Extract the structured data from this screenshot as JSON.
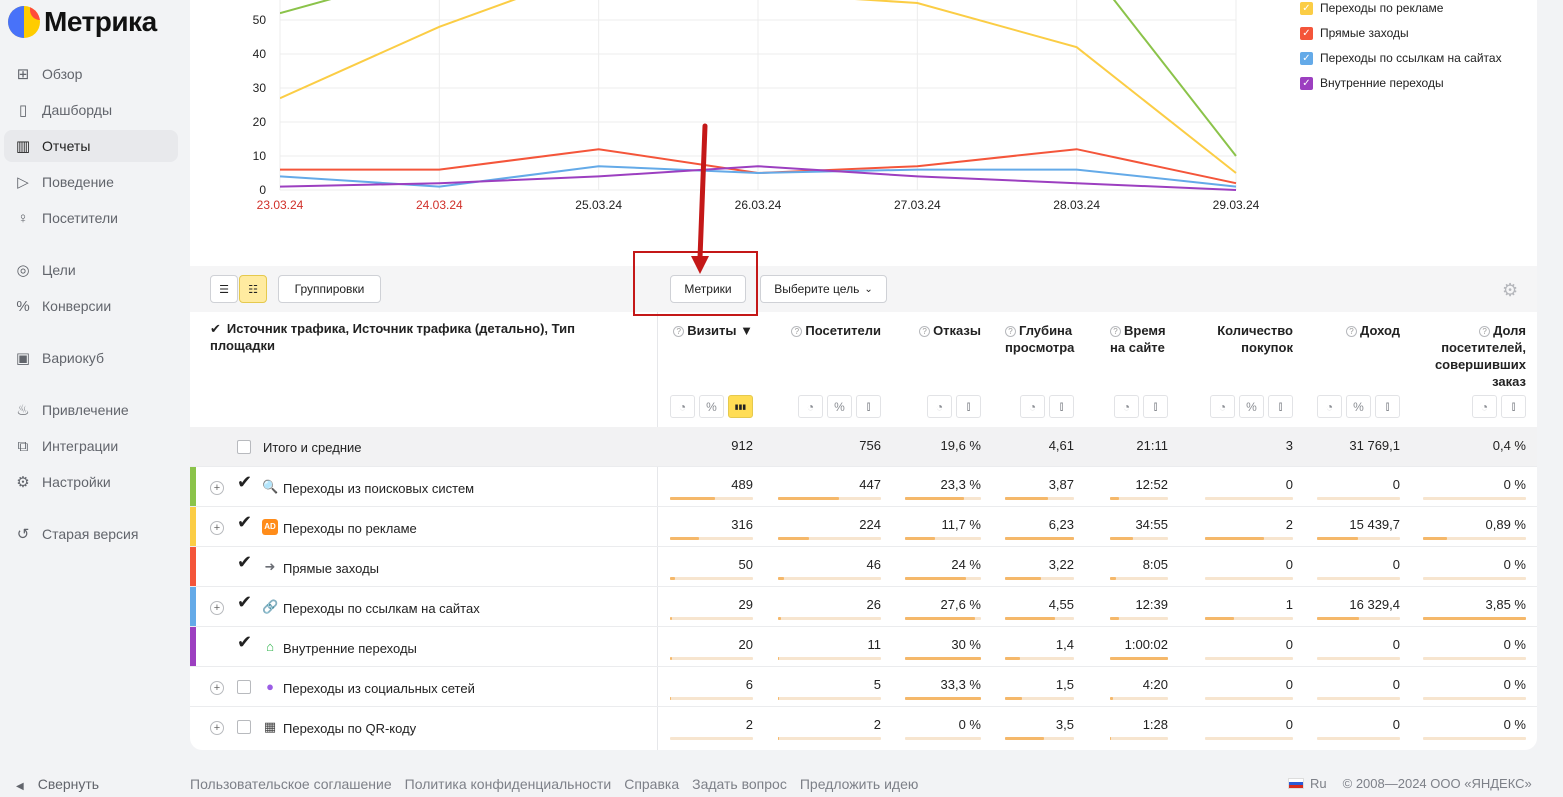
{
  "brand": {
    "name": "Метрика"
  },
  "nav": [
    {
      "label": "Обзор",
      "icon": "grid-icon"
    },
    {
      "label": "Дашборды",
      "icon": "dashboard-icon"
    },
    {
      "label": "Отчеты",
      "icon": "bar-chart-icon",
      "active": true
    },
    {
      "label": "Поведение",
      "icon": "play-icon"
    },
    {
      "label": "Посетители",
      "icon": "person-icon"
    },
    {
      "label": "Цели",
      "icon": "target-icon"
    },
    {
      "label": "Конверсии",
      "icon": "percent-icon"
    },
    {
      "label": "Вариокуб",
      "icon": "cube-icon"
    },
    {
      "label": "Привлечение",
      "icon": "fire-icon"
    },
    {
      "label": "Интеграции",
      "icon": "puzzle-icon"
    },
    {
      "label": "Настройки",
      "icon": "gear-icon"
    },
    {
      "label": "Старая версия",
      "icon": "undo-icon"
    }
  ],
  "collapse_label": "Свернуть",
  "chart_data": {
    "type": "line",
    "x": [
      "23.03.24",
      "24.03.24",
      "25.03.24",
      "26.03.24",
      "27.03.24",
      "28.03.24",
      "29.03.24"
    ],
    "weekend_x": [
      "23.03.24",
      "24.03.24"
    ],
    "yticks": [
      0,
      10,
      20,
      30,
      40,
      50
    ],
    "ylim": [
      0,
      56
    ],
    "series": [
      {
        "name": "",
        "color": "#8bc34a",
        "values": [
          52,
          65,
          75,
          78,
          80,
          70,
          10
        ]
      },
      {
        "name": "Переходы по рекламе",
        "color": "#fbcd45",
        "values": [
          27,
          48,
          65,
          58,
          55,
          42,
          5
        ]
      },
      {
        "name": "Прямые заходы",
        "color": "#f4553a",
        "values": [
          6,
          6,
          12,
          5,
          7,
          12,
          2
        ]
      },
      {
        "name": "Переходы по ссылкам на сайтах",
        "color": "#64aae8",
        "values": [
          4,
          1,
          7,
          5,
          6,
          6,
          1
        ]
      },
      {
        "name": "Внутренние переходы",
        "color": "#9c3fc0",
        "values": [
          1,
          2,
          4,
          7,
          4,
          2,
          0
        ]
      }
    ]
  },
  "toolbar": {
    "groupings_label": "Группировки",
    "metrics_label": "Метрики",
    "goal_label": "Выберите цель"
  },
  "table": {
    "dimension_header": "Источник трафика, Источник трафика (детально), Тип площадки",
    "columns": [
      {
        "title": "Визиты ▼",
        "help": true,
        "buttons": [
          "pie",
          "percent",
          "bars-on"
        ]
      },
      {
        "title": "Посетители",
        "help": true,
        "buttons": [
          "pie",
          "percent",
          "bars"
        ]
      },
      {
        "title": "Отказы",
        "help": true,
        "buttons": [
          "pie",
          "bars"
        ]
      },
      {
        "title": "Глубина просмотра",
        "help": true,
        "buttons": [
          "pie",
          "bars"
        ]
      },
      {
        "title": "Время на сайте",
        "help": true,
        "buttons": [
          "pie",
          "bars"
        ]
      },
      {
        "title": "Количество покупок",
        "help": false,
        "buttons": [
          "pie",
          "percent",
          "bars"
        ]
      },
      {
        "title": "Доход",
        "help": true,
        "buttons": [
          "pie",
          "percent",
          "bars"
        ]
      },
      {
        "title": "Доля посетителей, совершивших заказ",
        "help": true,
        "buttons": [
          "pie",
          "bars"
        ]
      }
    ],
    "total": {
      "label": "Итого и средние",
      "values": [
        "912",
        "756",
        "19,6 %",
        "4,61",
        "21:11",
        "3",
        "31 769,1",
        "0,4 %"
      ]
    },
    "rows": [
      {
        "label": "Переходы из поисковых систем",
        "stripe": "#8bc34a",
        "expand": true,
        "checked": true,
        "icon": "🔍",
        "icon_name": "search-icon",
        "icon_color": "#e84b3a",
        "values": [
          "489",
          "447",
          "23,3 %",
          "3,87",
          "12:52",
          "0",
          "0",
          "0 %"
        ],
        "bars": [
          0.54,
          0.59,
          0.78,
          0.62,
          0.15,
          0,
          0,
          0
        ]
      },
      {
        "label": "Переходы по рекламе",
        "stripe": "#fbcd45",
        "expand": true,
        "checked": true,
        "icon": "AD",
        "icon_name": "ad-icon",
        "icon_color": "#ff8c1a",
        "values": [
          "316",
          "224",
          "11,7 %",
          "6,23",
          "34:55",
          "2",
          "15 439,7",
          "0,89 %"
        ],
        "bars": [
          0.35,
          0.3,
          0.39,
          1.0,
          0.4,
          0.67,
          0.49,
          0.23
        ]
      },
      {
        "label": "Прямые заходы",
        "stripe": "#f4553a",
        "expand": false,
        "checked": true,
        "icon": "➜",
        "icon_name": "direct-icon",
        "icon_color": "#6b6e75",
        "values": [
          "50",
          "46",
          "24 %",
          "3,22",
          "8:05",
          "0",
          "0",
          "0 %"
        ],
        "bars": [
          0.06,
          0.06,
          0.8,
          0.52,
          0.1,
          0,
          0,
          0
        ]
      },
      {
        "label": "Переходы по ссылкам на сайтах",
        "stripe": "#64aae8",
        "expand": true,
        "checked": true,
        "icon": "🔗",
        "icon_name": "link-icon",
        "icon_color": "#3b82d8",
        "values": [
          "29",
          "26",
          "27,6 %",
          "4,55",
          "12:39",
          "1",
          "16 329,4",
          "3,85 %"
        ],
        "bars": [
          0.03,
          0.03,
          0.92,
          0.73,
          0.15,
          0.33,
          0.51,
          1.0
        ]
      },
      {
        "label": "Внутренние переходы",
        "stripe": "#9c3fc0",
        "expand": false,
        "checked": true,
        "icon": "⌂",
        "icon_name": "home-icon",
        "icon_color": "#2db34a",
        "values": [
          "20",
          "11",
          "30 %",
          "1,4",
          "1:00:02",
          "0",
          "0",
          "0 %"
        ],
        "bars": [
          0.02,
          0.01,
          1.0,
          0.22,
          1.0,
          0,
          0,
          0
        ]
      },
      {
        "label": "Переходы из социальных сетей",
        "stripe": "",
        "expand": true,
        "checked": false,
        "icon": "●",
        "icon_name": "social-icon",
        "icon_color": "#9b5de5",
        "values": [
          "6",
          "5",
          "33,3 %",
          "1,5",
          "4:20",
          "0",
          "0",
          "0 %"
        ],
        "bars": [
          0.01,
          0.01,
          1.0,
          0.24,
          0.05,
          0,
          0,
          0
        ]
      },
      {
        "label": "Переходы по QR-коду",
        "stripe": "",
        "expand": true,
        "checked": false,
        "icon": "▦",
        "icon_name": "qr-code-icon",
        "icon_color": "#444",
        "values": [
          "2",
          "2",
          "0 %",
          "3,5",
          "1:28",
          "0",
          "0",
          "0 %"
        ],
        "bars": [
          0.005,
          0.005,
          0,
          0.56,
          0.02,
          0,
          0,
          0
        ]
      }
    ]
  },
  "footer": {
    "links": [
      "Пользовательское соглашение",
      "Политика конфиденциальности",
      "Справка",
      "Задать вопрос",
      "Предложить идею"
    ],
    "lang": "Ru",
    "copyright": "© 2008—2024 ООО «ЯНДЕКС»"
  }
}
